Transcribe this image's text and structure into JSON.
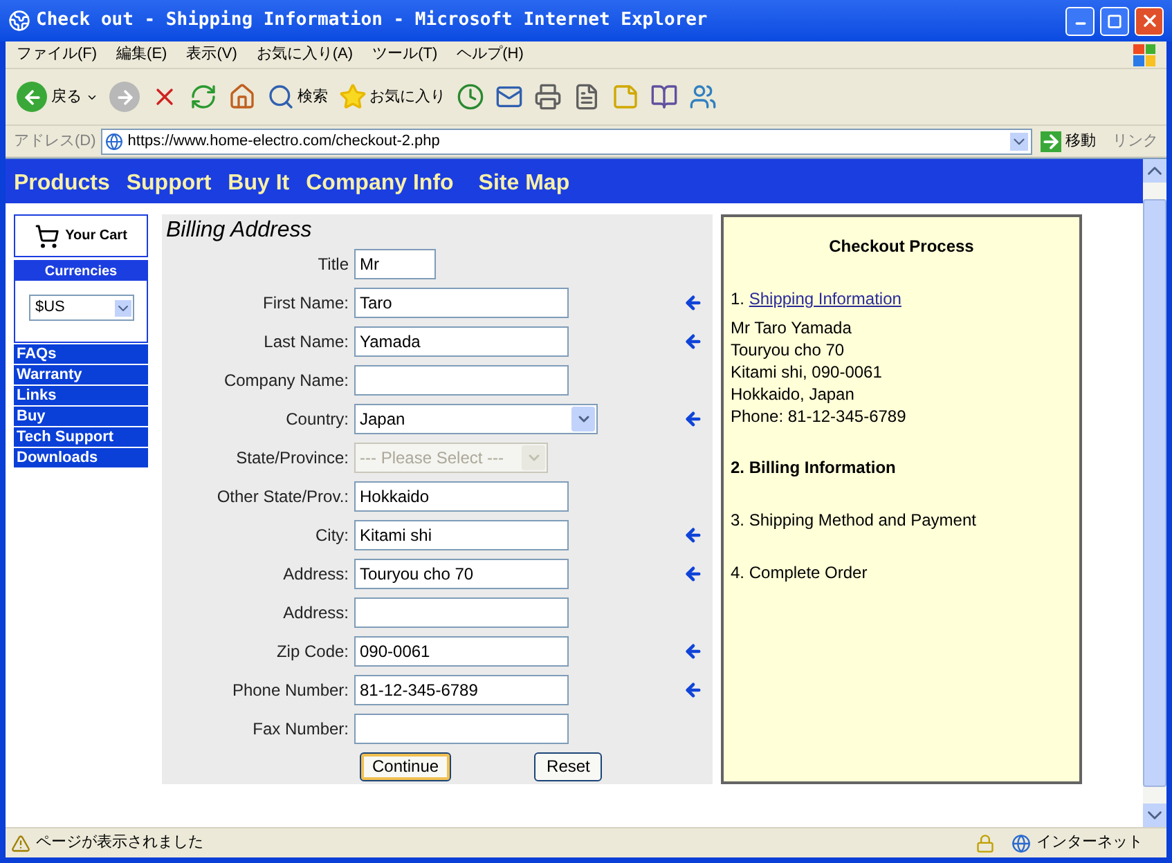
{
  "window": {
    "title": "Check out - Shipping Information - Microsoft Internet Explorer"
  },
  "menu": [
    "ファイル(F)",
    "編集(E)",
    "表示(V)",
    "お気に入り(A)",
    "ツール(T)",
    "ヘルプ(H)"
  ],
  "toolbar": {
    "back": "戻る",
    "search": "検索",
    "favorites": "お気に入り"
  },
  "address_bar": {
    "label": "アドレス(D)",
    "url": "https://www.home-electro.com/checkout-2.php",
    "go": "移動",
    "links": "リンク"
  },
  "nav": [
    "Products",
    "Support",
    "Buy It",
    "Company Info",
    "Site Map"
  ],
  "sidebar": {
    "cart": "Your Cart",
    "currencies": {
      "title": "Currencies",
      "value": "$US"
    },
    "links": [
      "FAQs",
      "Warranty",
      "Links",
      "Buy",
      "Tech Support",
      "Downloads"
    ]
  },
  "form": {
    "title": "Billing Address",
    "fields": [
      {
        "label": "Title",
        "kind": "short-text",
        "value": "Mr",
        "required": false,
        "disabled": false
      },
      {
        "label": "First Name:",
        "kind": "text",
        "value": "Taro",
        "required": true,
        "disabled": false
      },
      {
        "label": "Last Name:",
        "kind": "text",
        "value": "Yamada",
        "required": true,
        "disabled": false
      },
      {
        "label": "Company Name:",
        "kind": "text",
        "required": false,
        "disabled": false
      },
      {
        "label": "Country:",
        "kind": "select",
        "value": "Japan",
        "required": true,
        "disabled": false
      },
      {
        "label": "State/Province:",
        "kind": "select",
        "value": "--- Please Select ---",
        "required": false,
        "disabled": true
      },
      {
        "label": "Other State/Prov.:",
        "kind": "text",
        "value": "Hokkaido",
        "required": false,
        "disabled": false
      },
      {
        "label": "City:",
        "kind": "text",
        "value": "Kitami shi",
        "required": true,
        "disabled": false
      },
      {
        "label": "Address:",
        "kind": "text",
        "value": "Touryou cho 70",
        "required": true,
        "disabled": false
      },
      {
        "label": "Address:",
        "kind": "text",
        "required": false,
        "disabled": false
      },
      {
        "label": "Zip Code:",
        "kind": "text",
        "value": "090-0061",
        "required": true,
        "disabled": false
      },
      {
        "label": "Phone Number:",
        "kind": "text",
        "value": "81-12-345-6789",
        "required": true,
        "disabled": false
      },
      {
        "label": "Fax Number:",
        "kind": "text",
        "required": false,
        "disabled": false
      }
    ],
    "buttons": [
      {
        "label": "Continue",
        "focused": true
      },
      {
        "label": "Reset",
        "focused": false
      }
    ]
  },
  "checkout": {
    "title": "Checkout Process",
    "steps": [
      {
        "number": "1.",
        "label": "Shipping Information",
        "kind": "link",
        "details": [
          "Mr Taro Yamada",
          "Touryou cho 70",
          "Kitami shi, 090-0061",
          "Hokkaido, Japan",
          "Phone: 81-12-345-6789"
        ]
      },
      {
        "number": "2.",
        "label": "Billing Information",
        "kind": "current"
      },
      {
        "number": "3.",
        "label": "Shipping Method and Payment",
        "kind": "plain"
      },
      {
        "number": "4.",
        "label": "Complete Order",
        "kind": "plain"
      }
    ]
  },
  "status_bar": {
    "message": "ページが表示されました",
    "zone": "インターネット"
  }
}
